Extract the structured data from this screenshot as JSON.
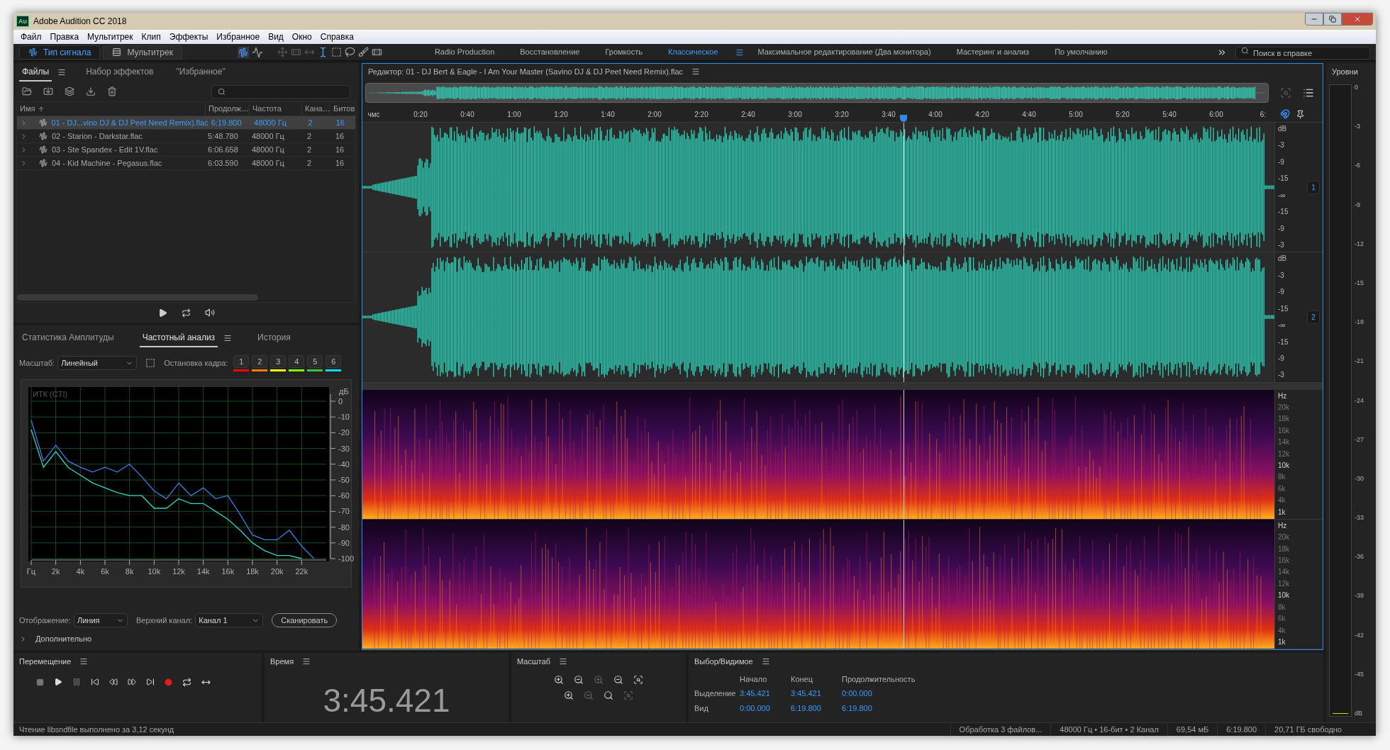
{
  "window": {
    "logo": "Au",
    "title": "Adobe Audition CC 2018"
  },
  "menu": [
    "Файл",
    "Правка",
    "Мультитрек",
    "Клип",
    "Эффекты",
    "Избранное",
    "Вид",
    "Окно",
    "Справка"
  ],
  "toolbar": {
    "views": [
      {
        "label": "Тип сигнала",
        "selected": true
      },
      {
        "label": "Мультитрек",
        "selected": false
      }
    ],
    "workspaces": [
      {
        "label": "Radio Production",
        "selected": false
      },
      {
        "label": "Восстановление",
        "selected": false
      },
      {
        "label": "Громкость",
        "selected": false
      },
      {
        "label": "Классическое",
        "selected": true
      },
      {
        "label": "Максимальное редактирование (Два монитора)",
        "selected": false
      },
      {
        "label": "Мастеринг и анализ",
        "selected": false
      },
      {
        "label": "По умолчанию",
        "selected": false
      }
    ],
    "search": {
      "placeholder": "Поиск в справке"
    }
  },
  "files_panel": {
    "tabs": [
      {
        "label": "Файлы",
        "selected": true
      },
      {
        "label": "Набор эффектов",
        "selected": false
      },
      {
        "label": "\"Избранное\"",
        "selected": false
      }
    ],
    "columns": [
      "Имя",
      "Продолж…",
      "Частота",
      "Кана…",
      "Битов"
    ],
    "rows": [
      {
        "name": "01 - DJ...vino DJ & DJ Peet Need Remix).flac",
        "duration": "6:19.800",
        "rate": "48000 Гц",
        "channels": "2",
        "bits": "16",
        "selected": true
      },
      {
        "name": "02 - Starion - Darkstar.flac",
        "duration": "5:48.780",
        "rate": "48000 Гц",
        "channels": "2",
        "bits": "16",
        "selected": false
      },
      {
        "name": "03 - Ste Spandex - Edit 1V.flac",
        "duration": "6:06.658",
        "rate": "48000 Гц",
        "channels": "2",
        "bits": "16",
        "selected": false
      },
      {
        "name": "04 - Kid Machine - Pegasus.flac",
        "duration": "6:03.590",
        "rate": "48000 Гц",
        "channels": "2",
        "bits": "16",
        "selected": false
      }
    ]
  },
  "frequency_panel": {
    "tabs": [
      {
        "label": "Статистика Амплитуды",
        "selected": false
      },
      {
        "label": "Частотный анализ",
        "selected": true
      },
      {
        "label": "История",
        "selected": false
      }
    ],
    "scale_label": "Масштаб:",
    "scale_value": "Линейный",
    "freeze_label": "Остановка кадра:",
    "freeze_buttons": [
      {
        "label": "1",
        "color": "#ff0000"
      },
      {
        "label": "2",
        "color": "#ff8000"
      },
      {
        "label": "3",
        "color": "#ffff00"
      },
      {
        "label": "4",
        "color": "#80ff00"
      },
      {
        "label": "5",
        "color": "#40c040"
      },
      {
        "label": "6",
        "color": "#00e0ff"
      }
    ],
    "chart_data": {
      "type": "line",
      "grid": true,
      "title": "ИТК (CTI)",
      "ylabel": "дБ",
      "x": [
        0,
        1,
        2,
        3,
        4,
        5,
        6,
        7,
        8,
        9,
        10,
        11,
        12,
        13,
        14,
        15,
        16,
        17,
        18,
        19,
        20,
        21,
        22,
        23
      ],
      "series": [
        {
          "color": "#3f7fe0",
          "values": [
            -12,
            -38,
            -28,
            -38,
            -42,
            -45,
            -42,
            -45,
            -40,
            -48,
            -57,
            -62,
            -52,
            -60,
            -55,
            -62,
            -60,
            -72,
            -85,
            -88,
            -88,
            -82,
            -92,
            -100
          ]
        },
        {
          "color": "#2fd8c0",
          "values": [
            -18,
            -42,
            -32,
            -42,
            -47,
            -52,
            -55,
            -58,
            -60,
            -60,
            -68,
            -68,
            -62,
            -65,
            -65,
            -70,
            -75,
            -82,
            -90,
            -95,
            -98,
            -98,
            -100,
            null
          ]
        }
      ],
      "xlim": [
        0,
        24
      ],
      "ylim": [
        -100,
        0
      ],
      "xticks": [
        {
          "value": 0,
          "label": "Гц"
        },
        {
          "value": 2,
          "label": "2k"
        },
        {
          "value": 4,
          "label": "4k"
        },
        {
          "value": 6,
          "label": "6k"
        },
        {
          "value": 8,
          "label": "8k"
        },
        {
          "value": 10,
          "label": "10k"
        },
        {
          "value": 12,
          "label": "12k"
        },
        {
          "value": 14,
          "label": "14k"
        },
        {
          "value": 16,
          "label": "16k"
        },
        {
          "value": 18,
          "label": "18k"
        },
        {
          "value": 20,
          "label": "20k"
        },
        {
          "value": 22,
          "label": "22k"
        }
      ],
      "yticks": [
        0,
        -10,
        -20,
        -30,
        -40,
        -50,
        -60,
        -70,
        -80,
        -90,
        -100
      ]
    },
    "display_label": "Отображение:",
    "display_value": "Линия",
    "channel_label": "Верхний канал:",
    "channel_value": "Канал 1",
    "scan_button": "Сканировать",
    "advanced": "Дополнительно"
  },
  "editor": {
    "title": "Редактор: 01 - DJ Bert & Eagle - I Am Your Master (Savino DJ & DJ Peet Need Remix).flac",
    "ruler": [
      "чмс",
      "0:20",
      "0:40",
      "1:00",
      "1:20",
      "1:40",
      "2:00",
      "2:20",
      "2:40",
      "3:00",
      "3:20",
      "3:40",
      "4:00",
      "4:20",
      "4:40",
      "5:00",
      "5:20",
      "5:40",
      "6:00",
      "6:"
    ],
    "channels": [
      {
        "badge": "1",
        "scale": [
          "dB",
          "-3",
          "-9",
          "-15",
          "-∞",
          "-15",
          "-9",
          "-3"
        ]
      },
      {
        "badge": "2",
        "scale": [
          "dB",
          "-3",
          "-9",
          "-15",
          "-∞",
          "-15",
          "-9",
          "-3"
        ]
      }
    ],
    "spectral_scales": [
      [
        "Hz",
        "20k",
        "18k",
        "16k",
        "14k",
        "12k",
        "10k",
        "8k",
        "6k",
        "4k",
        "1k"
      ],
      [
        "Hz",
        "20k",
        "18k",
        "16k",
        "14k",
        "12k",
        "10k",
        "8k",
        "6k",
        "4k",
        "1k"
      ]
    ]
  },
  "levels": {
    "title": "Уровни",
    "scale": [
      "0",
      "-3",
      "-6",
      "-9",
      "-12",
      "-15",
      "-18",
      "-21",
      "-24",
      "-27",
      "-30",
      "-33",
      "-36",
      "-39",
      "-42",
      "-45",
      "dB"
    ]
  },
  "transport": {
    "title": "Перемещение"
  },
  "time": {
    "title": "Время",
    "value": "3:45.421"
  },
  "zoom": {
    "title": "Масштаб"
  },
  "selection": {
    "title": "Выбор/Видимое",
    "columns": [
      "Начало",
      "Конец",
      "Продолжительность"
    ],
    "rows": [
      {
        "label": "Выделение",
        "values": [
          "3:45.421",
          "3:45.421",
          "0:00.000"
        ]
      },
      {
        "label": "Вид",
        "values": [
          "0:00.000",
          "6:19.800",
          "6:19.800"
        ]
      }
    ]
  },
  "status_bar": {
    "message": "Чтение libsndfile выполнено за 3,12 секунд",
    "items": [
      "Обработка 3 файлов...",
      "48000 Гц • 16-бит • 2 Канал",
      "69,54 мБ",
      "6:19.800",
      "20,71 ГБ свободно"
    ]
  }
}
